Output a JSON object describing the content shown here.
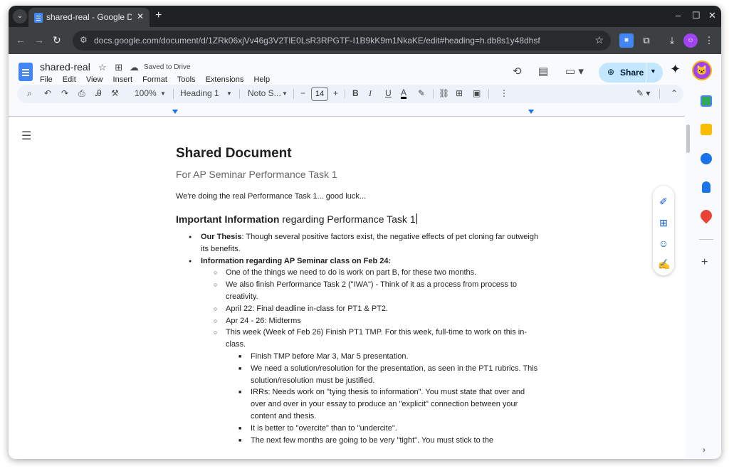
{
  "browser": {
    "tab_title": "shared-real - Google Docs",
    "tab_close": "✕",
    "new_tab": "+",
    "url": "docs.google.com/document/d/1ZRk06xjVv46g3V2TlE0LsR3RPGTF-I1B9kK9m1NkaKE/edit#heading=h.db8s1y48dhsf",
    "window_controls": [
      "–",
      "☐",
      "✕"
    ]
  },
  "docs": {
    "title": "shared-real",
    "saved_status": "Saved to Drive",
    "menu": [
      "File",
      "Edit",
      "View",
      "Insert",
      "Format",
      "Tools",
      "Extensions",
      "Help"
    ],
    "share_label": "Share",
    "avatar_initial": "🐱"
  },
  "toolbar": {
    "zoom": "100%",
    "style": "Heading 1",
    "font": "Noto S...",
    "font_size": "14",
    "bold": "B",
    "italic": "I",
    "underline": "U",
    "text_color": "A"
  },
  "document": {
    "title": "Shared Document",
    "subtitle": "For AP Seminar Performance Task 1",
    "intro": "We're doing the real Performance Task 1... good luck...",
    "heading_bold": "Important Information",
    "heading_rest": " regarding Performance Task 1",
    "bullets": [
      {
        "level": 1,
        "bold": "Our Thesis",
        "text": ": Though several positive factors exist, the negative effects of pet cloning far outweigh its benefits."
      },
      {
        "level": 1,
        "bold": "Information regarding AP Seminar class on Feb 24:",
        "text": ""
      },
      {
        "level": 2,
        "bold": "",
        "text": "One of the things we need to do is work on part B, for these two months."
      },
      {
        "level": 2,
        "bold": "",
        "text": "We also finish Performance Task 2 (\"IWA\") - Think of it as a process from process to creativity."
      },
      {
        "level": 2,
        "bold": "",
        "text": "April 22: Final deadline in-class for PT1 & PT2."
      },
      {
        "level": 2,
        "bold": "",
        "text": "Apr 24 - 26: Midterms"
      },
      {
        "level": 2,
        "bold": "",
        "text": "This week (Week of Feb 26) Finish PT1 TMP. For this week, full-time to work on this in-class."
      },
      {
        "level": 3,
        "bold": "",
        "text": "Finish TMP before Mar 3, Mar 5 presentation."
      },
      {
        "level": 3,
        "bold": "",
        "text": "We need a solution/resolution for the presentation, as seen in the PT1 rubrics. This solution/resolution must be justified."
      },
      {
        "level": 3,
        "bold": "",
        "text": "IRRs: Needs work on \"tying thesis to information\". You must state that over and over and over in your essay to produce an \"explicit\" connection between your content and thesis."
      },
      {
        "level": 3,
        "bold": "",
        "text": "It is better to \"overcite\" than to \"undercite\"."
      },
      {
        "level": 3,
        "bold": "",
        "text": "The next few months are going to be very \"tight\". You must stick to the"
      }
    ]
  },
  "colors": {
    "accent": "#0b57d0",
    "share_bg": "#c2e7ff",
    "docs_blue": "#4285f4"
  }
}
